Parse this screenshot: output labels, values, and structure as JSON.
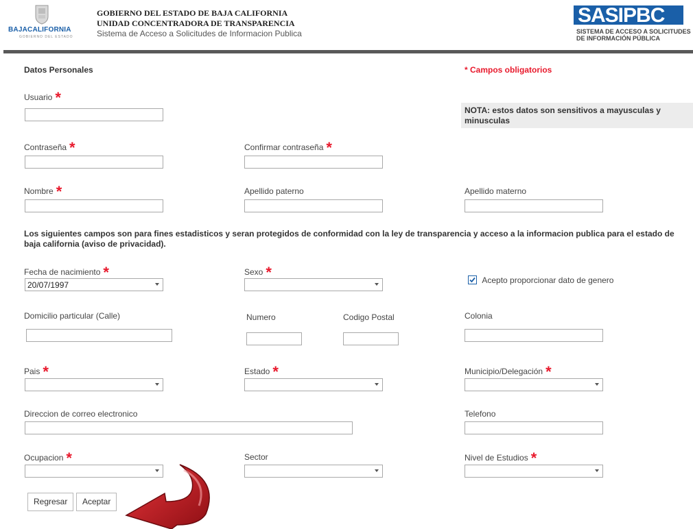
{
  "header": {
    "left_logo_text": "BAJACALIFORNIA",
    "left_logo_sub": "GOBIERNO DEL ESTADO",
    "title_line1": "GOBIERNO DEL ESTADO DE BAJA CALIFORNIA",
    "title_line2": "UNIDAD CONCENTRADORA DE TRANSPARENCIA",
    "title_line3": "Sistema de Acceso a Solicitudes de Informacion Publica",
    "right_logo_text": "SASIPBC",
    "right_logo_sub1": "SISTEMA DE ACCESO A SOLICITUDES",
    "right_logo_sub2": "DE INFORMACIÓN PÚBLICA"
  },
  "section_title": "Datos Personales",
  "required_note": "* Campos obligatorios",
  "nota": "NOTA: estos datos son sensitivos a mayusculas y minusculas",
  "fields": {
    "usuario": "Usuario",
    "contrasena": "Contraseña",
    "confirmar": "Confirmar contraseña",
    "nombre": "Nombre",
    "apellido_paterno": "Apellido paterno",
    "apellido_materno": "Apellido materno",
    "fecha_nacimiento": "Fecha de nacimiento",
    "fecha_value": "20/07/1997",
    "sexo": "Sexo",
    "acepto_genero": "Acepto proporcionar dato de genero",
    "domicilio": "Domicilio particular (Calle)",
    "numero": "Numero",
    "codigo_postal": "Codigo Postal",
    "colonia": "Colonia",
    "pais": "Pais",
    "estado": "Estado",
    "municipio": "Municipio/Delegación",
    "correo": "Direccion de correo electronico",
    "telefono": "Telefono",
    "ocupacion": "Ocupacion",
    "sector": "Sector",
    "nivel_estudios": "Nivel de Estudios"
  },
  "stats_notice": "Los siguientes campos son para fines estadisticos y seran protegidos de conformidad con la ley de transparencia y acceso a la informacion publica para el estado de baja california (aviso de privacidad).",
  "buttons": {
    "regresar": "Regresar",
    "aceptar": "Aceptar"
  },
  "colors": {
    "required": "#e8192c",
    "brand_blue": "#1a5fa8",
    "header_bar": "#595959",
    "arrow": "#c4161c"
  }
}
